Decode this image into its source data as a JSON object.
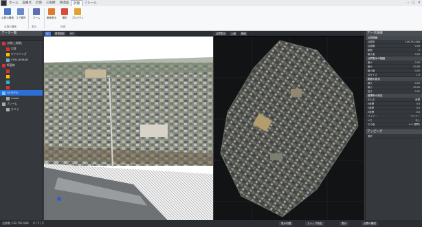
{
  "tabs": [
    "ホーム",
    "設備点",
    "計測",
    "三角網",
    "環境図",
    "計測",
    "フレーム"
  ],
  "active_tab_index": 5,
  "ribbon": {
    "buttons": [
      {
        "label": "点群の構造",
        "icon": "document-icon",
        "color": "#4a78c4"
      },
      {
        "label": "コア選択",
        "icon": "select-icon",
        "color": "#6a8ac8"
      },
      {
        "label": "ホーム",
        "icon": "home-icon",
        "color": "#5b6fb2"
      },
      {
        "label": "断面表示",
        "icon": "section-icon",
        "color": "#e07a2e"
      },
      {
        "label": "選択",
        "icon": "pointer-icon",
        "color": "#d94b3b"
      },
      {
        "label": "プロパティ",
        "icon": "properties-icon",
        "color": "#e0a230"
      }
    ],
    "groups": [
      "点群の構造",
      "表示",
      "計測"
    ]
  },
  "left_panel": {
    "title": "データ一覧",
    "tree": [
      {
        "label": "点群(三角網)",
        "color": "#d33",
        "indent": 0,
        "selected": false
      },
      {
        "label": "点群",
        "color": "#d33",
        "indent": 1,
        "selected": false
      },
      {
        "label": "ワイヤリング",
        "color": "#f6c000",
        "indent": 1,
        "selected": false
      },
      {
        "label": "4TIN_BOMAN",
        "color": "#7ab",
        "indent": 1,
        "selected": false
      },
      {
        "label": "断面線",
        "color": "#d33",
        "indent": 0,
        "selected": false
      },
      {
        "label": "",
        "color": "#e03030",
        "indent": 1,
        "selected": false
      },
      {
        "label": "",
        "color": "#f6c000",
        "indent": 1,
        "selected": false
      },
      {
        "label": "",
        "color": "#3ac",
        "indent": 1,
        "selected": false
      },
      {
        "label": "",
        "color": "#e03030",
        "indent": 1,
        "selected": false
      },
      {
        "label": "3Dモデル",
        "color": "#6cf",
        "indent": 0,
        "selected": true
      },
      {
        "label": "model",
        "color": "#aaa",
        "indent": 1,
        "selected": false
      },
      {
        "label": "フレーム",
        "color": "#aaa",
        "indent": 0,
        "selected": false
      },
      {
        "label": "カメラ",
        "color": "#aaa",
        "indent": 1,
        "selected": false
      }
    ]
  },
  "viewport1": {
    "buttons": [
      "3D",
      "透視投影",
      "90°"
    ],
    "active": 0,
    "zoom_value": "1.0"
  },
  "viewport2": {
    "buttons": [
      "点群表示",
      "上面",
      "側面"
    ]
  },
  "right_panel": {
    "title": "データ詳細",
    "sections": [
      {
        "name": "点群情報",
        "rows": [
          [
            "点群数",
            "239,792,948"
          ],
          [
            "点間隔",
            "0.05"
          ],
          [
            "範囲",
            "X"
          ],
          [
            "最大値",
            "0.05"
          ]
        ]
      },
      {
        "name": "点群表示の範囲",
        "rows": [
          [
            "最小",
            "0.00"
          ],
          [
            "最大",
            "50.00"
          ],
          [
            "最小値",
            "0.02"
          ],
          [
            "点サイズ",
            "1.0"
          ]
        ]
      },
      {
        "name": "範囲の設定",
        "rows": [
          [
            "最大",
            "0.00"
          ],
          [
            "最小",
            "50.00"
          ],
          [
            "高さ",
            "0.02"
          ]
        ]
      },
      {
        "name": "座標系の設定",
        "rows": [
          [
            "中心点",
            "座標"
          ],
          [
            "X座標",
            "0.0"
          ],
          [
            "Y座標",
            "0.0"
          ],
          [
            "Z座標",
            "0.0"
          ],
          [
            "ワイヤー",
            "ワイヤー"
          ],
          [
            "メモ",
            "なし"
          ],
          [
            "その他",
            "0.0 (標準)"
          ]
        ]
      }
    ],
    "selection_title": "マッピング",
    "selection_item": "選択"
  },
  "status": {
    "left_text": "点群数 239,792,948",
    "coord_text": "X / Y / Z",
    "buttons": [
      "表示切替",
      "スナップ設定",
      "表示",
      "点群の構成"
    ]
  }
}
